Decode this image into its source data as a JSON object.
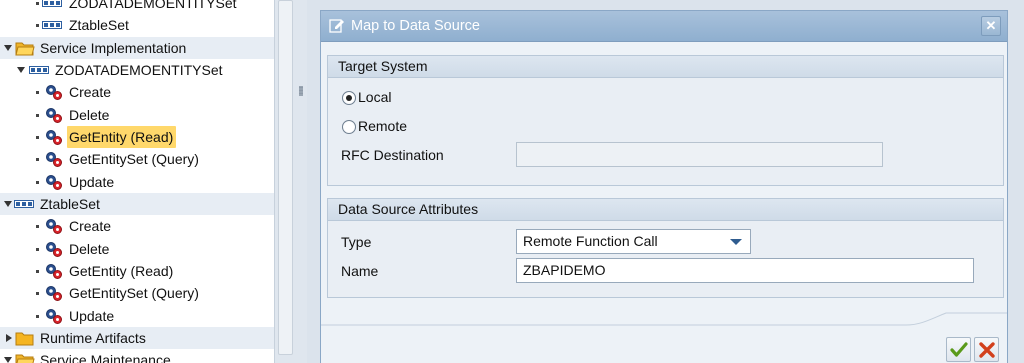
{
  "tree": {
    "items": [
      {
        "label": "ZODATADEMOENTITYSet"
      },
      {
        "label": "ZtableSet"
      },
      {
        "label": "Service Implementation"
      },
      {
        "label": "ZODATADEMOENTITYSet"
      },
      {
        "label": "Create"
      },
      {
        "label": "Delete"
      },
      {
        "label": "GetEntity (Read)"
      },
      {
        "label": "GetEntitySet (Query)"
      },
      {
        "label": "Update"
      },
      {
        "label": "ZtableSet"
      },
      {
        "label": "Create"
      },
      {
        "label": "Delete"
      },
      {
        "label": "GetEntity (Read)"
      },
      {
        "label": "GetEntitySet (Query)"
      },
      {
        "label": "Update"
      },
      {
        "label": "Runtime Artifacts"
      },
      {
        "label": "Service Maintenance"
      }
    ],
    "selected": "GetEntity (Read)"
  },
  "dialog": {
    "title": "Map to Data Source",
    "close_icon": "close-icon",
    "target_system": {
      "header": "Target System",
      "local_label": "Local",
      "remote_label": "Remote",
      "selected": "Local",
      "rfc_label": "RFC Destination",
      "rfc_value": ""
    },
    "attributes": {
      "header": "Data Source Attributes",
      "type_label": "Type",
      "type_value": "Remote Function Call",
      "name_label": "Name",
      "name_value": "ZBAPIDEMO"
    },
    "confirm_icon": "checkmark-icon",
    "cancel_icon": "cancel-x-icon"
  },
  "colors": {
    "title_bar": "#9ab6d4",
    "selection": "#ffd86b",
    "confirm": "#5a9a1a",
    "cancel": "#d2401c"
  }
}
